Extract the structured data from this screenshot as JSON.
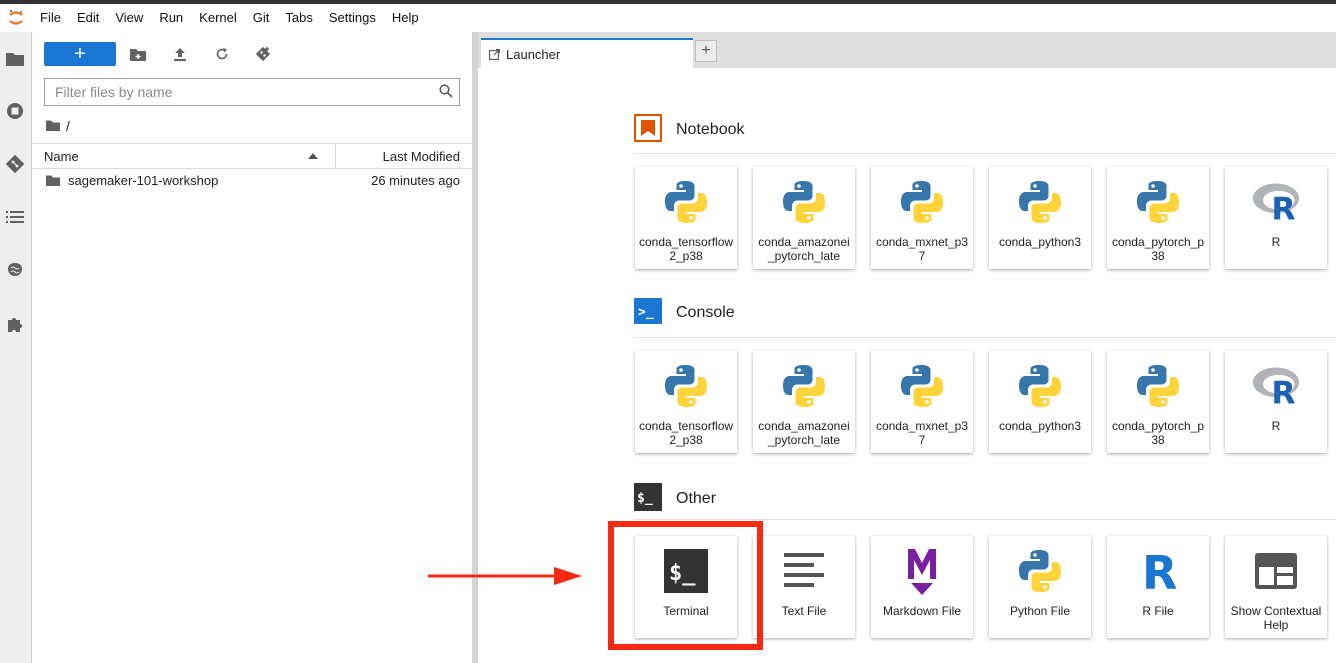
{
  "menubar": {
    "items": [
      "File",
      "Edit",
      "View",
      "Run",
      "Kernel",
      "Git",
      "Tabs",
      "Settings",
      "Help"
    ]
  },
  "leftbar": {
    "icons": [
      "folder-icon",
      "running-icon",
      "git-icon",
      "toc-icon",
      "brain-icon",
      "extensions-icon"
    ]
  },
  "filebrowser": {
    "new_label": "+",
    "filter_placeholder": "Filter files by name",
    "breadcrumb": "/",
    "columns": {
      "name": "Name",
      "modified": "Last Modified"
    },
    "files": [
      {
        "name": "sagemaker-101-workshop",
        "modified": "26 minutes ago"
      }
    ]
  },
  "tabs": [
    {
      "label": "Launcher"
    }
  ],
  "launcher": {
    "sections": {
      "notebook": {
        "title": "Notebook",
        "items": [
          "conda_tensorflow2_p38",
          "conda_amazonei_pytorch_late",
          "conda_mxnet_p37",
          "conda_python3",
          "conda_pytorch_p38",
          "R"
        ]
      },
      "console": {
        "title": "Console",
        "items": [
          "conda_tensorflow2_p38",
          "conda_amazonei_pytorch_late",
          "conda_mxnet_p37",
          "conda_python3",
          "conda_pytorch_p38",
          "R"
        ]
      },
      "other": {
        "title": "Other",
        "items": [
          "Terminal",
          "Text File",
          "Markdown File",
          "Python File",
          "R File",
          "Show Contextual Help"
        ]
      }
    },
    "icons": {
      "console_prompt": ">_",
      "terminal_prompt": "$_"
    }
  },
  "colors": {
    "accent": "#1976d2",
    "highlight": "#f52a10",
    "notebook_orange": "#e65100"
  }
}
